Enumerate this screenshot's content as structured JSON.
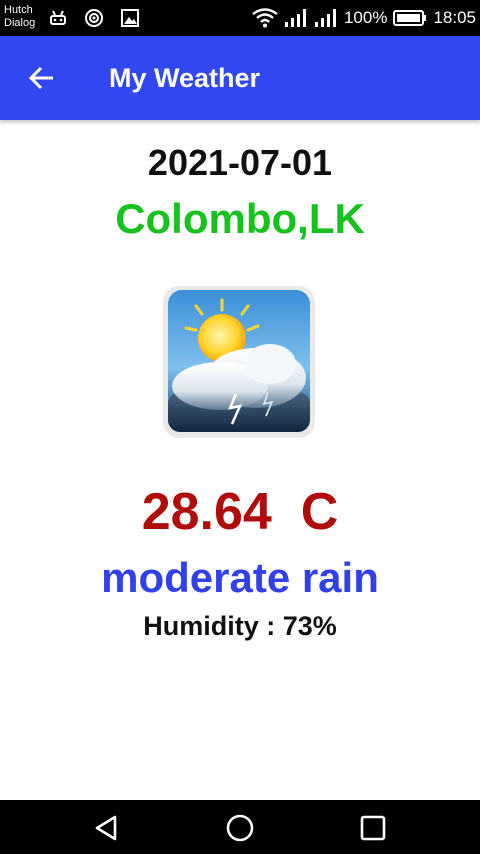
{
  "status_bar": {
    "carrier_line1": "Hutch",
    "carrier_line2": "Dialog",
    "battery_percent": "100%",
    "time": "18:05",
    "icons": [
      "android-debug-icon",
      "hotspot-icon",
      "image-icon",
      "wifi-icon",
      "signal-icon",
      "signal-icon",
      "battery-icon"
    ]
  },
  "app_bar": {
    "title": "My Weather",
    "back_icon": "arrow-left-icon"
  },
  "weather": {
    "date": "2021-07-01",
    "city": "Colombo,LK",
    "temperature": "28.64  C",
    "description": "moderate rain",
    "humidity_label": "Humidity : ",
    "humidity_value": "73%",
    "icon": "sun-cloud-thunderstorm-icon"
  },
  "nav_bar": {
    "icons": [
      "back-triangle-icon",
      "home-circle-icon",
      "recents-square-icon"
    ]
  },
  "colors": {
    "app_bar": "#3047f2",
    "city": "#18c21d",
    "temperature": "#b10c0c",
    "description": "#3040ea"
  }
}
